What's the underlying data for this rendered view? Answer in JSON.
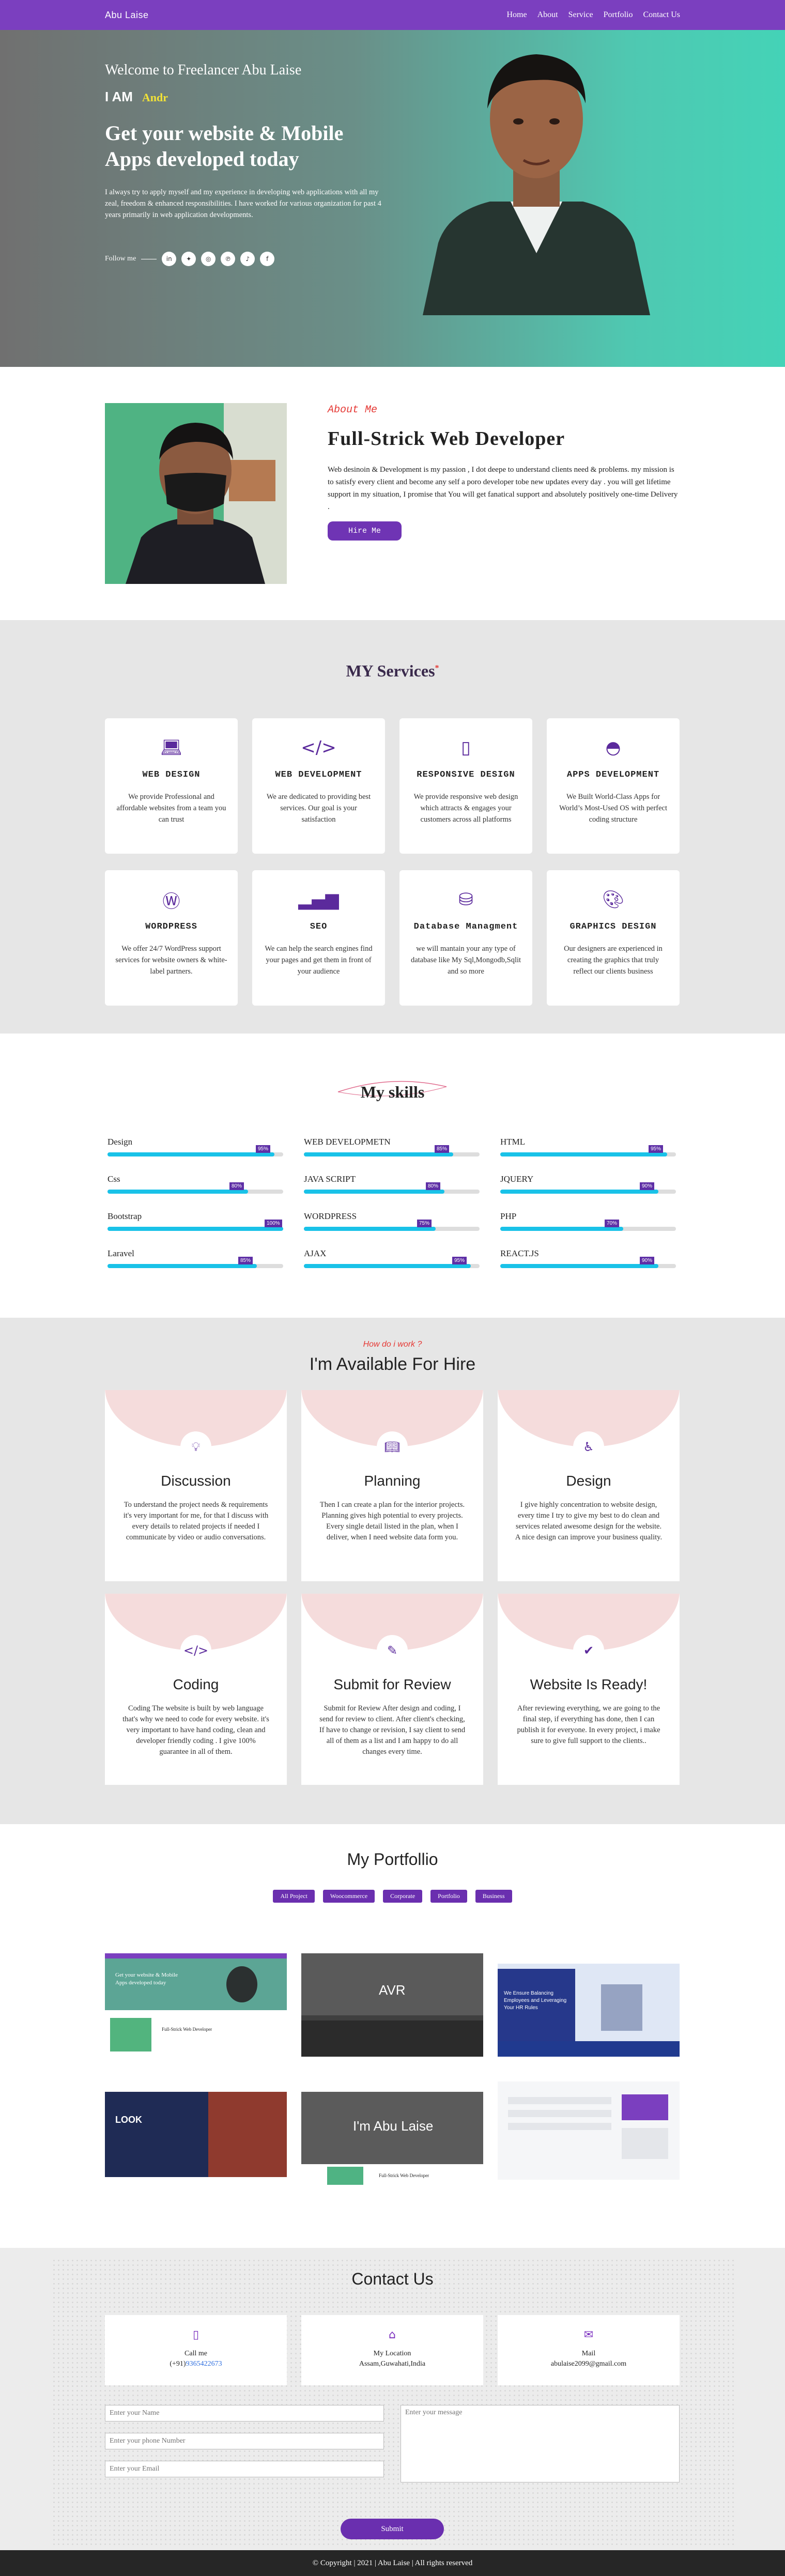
{
  "nav": {
    "brand": "Abu Laise",
    "links": [
      "Home",
      "About",
      "Service",
      "Portfolio",
      "Contact Us"
    ]
  },
  "hero": {
    "welcome": "Welcome to Freelancer Abu Laise",
    "iam": "I AM",
    "typed": "Andr",
    "headline_1": "Get your website & Mobile",
    "headline_2": "Apps developed today",
    "intro": "I always try to apply myself and my experience in developing web applications with all my zeal, freedom & enhanced responsibilities. I have worked for various organization for past 4 years primarily in web application developments.",
    "follow_label": "Follow me",
    "socials": [
      "linkedin-icon",
      "twitter-icon",
      "instagram-icon",
      "pinterest-icon",
      "tiktok-icon",
      "facebook-icon"
    ]
  },
  "about": {
    "eyebrow": "About Me",
    "title": "Full-Strick Web Developer",
    "body": "Web desinoin & Development is my passion , I dot deepe to understand clients need & problems. my mission is to satisfy every client and become any self a poro developer tobe new updates every day . you will get lifetime support in my situation, I promise that You will get fanatical support and absolutely positively one-time Delivery .",
    "button": "Hire Me"
  },
  "services": {
    "title": "MY Services",
    "title_mark": "*",
    "items": [
      {
        "icon": "laptop-icon",
        "title": "WEB DESIGN",
        "text": "We provide Professional and affordable websites from a team you can trust"
      },
      {
        "icon": "code-icon",
        "title": "WEB DEVELOPMENT",
        "text": "We are dedicated to providing best services. Our goal is your satisfaction"
      },
      {
        "icon": "mobile-icon",
        "title": "RESPONSIVE DESIGN",
        "text": "We provide responsive web design which attracts & engages your customers across all platforms"
      },
      {
        "icon": "android-icon",
        "title": "APPS DEVELOPMENT",
        "text": "We Built World-Class Apps for World’s Most-Used OS with perfect coding structure"
      },
      {
        "icon": "wordpress-icon",
        "title": "WORDPRESS",
        "text": "We offer 24/7 WordPress support services for website owners & white-label partners."
      },
      {
        "icon": "chart-icon",
        "title": "SEO",
        "text": "We can help the search engines find your pages and get them in front of your audience"
      },
      {
        "icon": "database-icon",
        "title": "Database Managment",
        "text": "we will mantain your any type of database like My Sql,Mongodb,Sqlit and so more"
      },
      {
        "icon": "palette-icon",
        "title": "GRAPHICS DESIGN",
        "text": "Our designers are experienced in creating the graphics that truly reflect our clients business"
      }
    ]
  },
  "skills": {
    "title": "My skills",
    "items": [
      {
        "name": "Design",
        "pct": "95%",
        "value": 0.95
      },
      {
        "name": "WEB DEVELOPMETN",
        "pct": "85%",
        "value": 0.85
      },
      {
        "name": "HTML",
        "pct": "95%",
        "value": 0.95
      },
      {
        "name": "Css",
        "pct": "80%",
        "value": 0.8
      },
      {
        "name": "JAVA SCRIPT",
        "pct": "80%",
        "value": 0.8
      },
      {
        "name": "JQUERY",
        "pct": "90%",
        "value": 0.9
      },
      {
        "name": "Bootstrap",
        "pct": "100%",
        "value": 1.0
      },
      {
        "name": "WORDPRESS",
        "pct": "75%",
        "value": 0.75
      },
      {
        "name": "PHP",
        "pct": "70%",
        "value": 0.7
      },
      {
        "name": "Laravel",
        "pct": "85%",
        "value": 0.85
      },
      {
        "name": "AJAX",
        "pct": "95%",
        "value": 0.95
      },
      {
        "name": "REACT.JS",
        "pct": "90%",
        "value": 0.9
      }
    ]
  },
  "process": {
    "eyebrow": "How do i work ?",
    "title": "I'm Available For Hire",
    "steps": [
      {
        "icon": "bulb-icon",
        "title": "Discussion",
        "text": "To understand the project needs & requirements it's very important for me, for that I discuss with every details to related projects if needed I communicate by video or audio conversations."
      },
      {
        "icon": "book-icon",
        "title": "Planning",
        "text": "Then I can create a plan for the interior projects. Planning gives high potential to every projects. Every single detail listed in the plan, when I deliver, when I need website data form you."
      },
      {
        "icon": "accessibility-icon",
        "title": "Design",
        "text": "I give highly concentration to website design, every time I try to give my best to do clean and services related awesome design for the website. A nice design can improve your business quality."
      },
      {
        "icon": "code-icon",
        "title": "Coding",
        "text": "Coding The website is built by web language that's why we need to code for every website. it's very important to have hand coding, clean and developer friendly coding . I give 100% guarantee in all of them."
      },
      {
        "icon": "user-edit-icon",
        "title": "Submit for Review",
        "text": "Submit for Review After design and coding, I send for review to client. After client's checking, If have to change or revision, I say client to send all of them as a list and I am happy to do all changes every time."
      },
      {
        "icon": "check-icon",
        "title": "Website Is Ready!",
        "text": "After reviewing everything, we are going to the final step, if everything has done, then I can publish it for everyone. In every project, i make sure to give full support to the clients.."
      }
    ]
  },
  "portfolio": {
    "title": "My Portfollio",
    "filters": [
      "All Project",
      "Woocommerce",
      "Corporate",
      "Portfolio",
      "Business"
    ],
    "thumb5_text": "I'm Abu Laise",
    "thumb5_caption": "Full-Strick Web Developer",
    "thumb1_headline": "Get your website & Mobile Apps developed today",
    "thumb1_sub": "Full-Strick Web Developer",
    "thumb3_headline": "We Ensure Balancing Employees and Leveraging Your HR Rules",
    "thumb4_headline": "LOOK",
    "thumb2_logo": "AVR"
  },
  "contact": {
    "title": "Contact Us",
    "cards": [
      {
        "icon": "mobile-icon",
        "label": "Call me",
        "prefix": "(+91)",
        "value": "9365422673"
      },
      {
        "icon": "home-icon",
        "label": "My Location",
        "value": "Assam,Guwahati,India"
      },
      {
        "icon": "mail-icon",
        "label": "Mail",
        "value": "abulaise2099@gmail.com"
      }
    ],
    "name_placeholder": "Enter your Name",
    "phone_placeholder": "Enter your phone Number",
    "email_placeholder": "Enter your Email",
    "message_placeholder": "Enter your message",
    "submit": "Submit"
  },
  "footer": {
    "text": "© Copyright | 2021 | Abu Laise | All rights reserved"
  }
}
